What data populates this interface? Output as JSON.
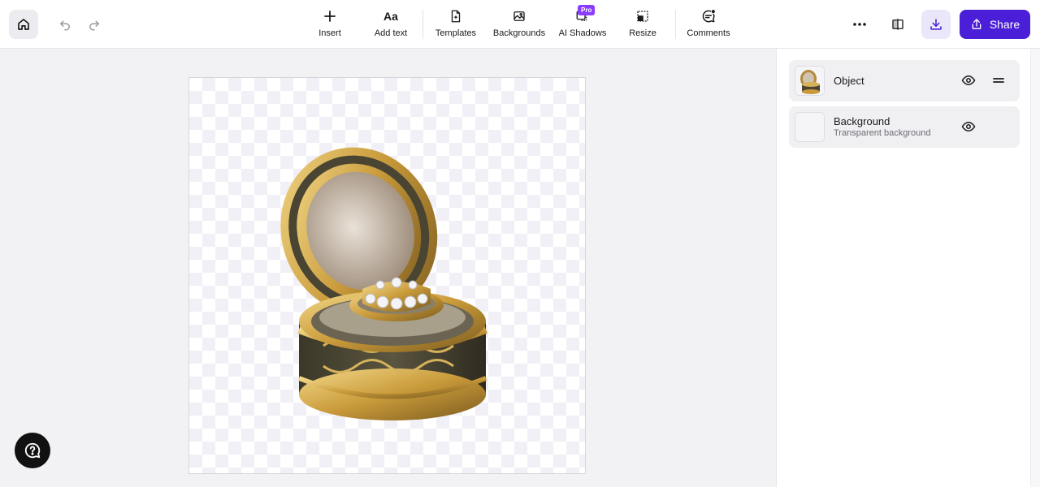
{
  "toolbar": {
    "tools": [
      {
        "label": "Insert",
        "icon": "plus-icon"
      },
      {
        "label": "Add text",
        "icon": "text-icon"
      },
      {
        "label": "Templates",
        "icon": "templates-icon"
      },
      {
        "label": "Backgrounds",
        "icon": "backgrounds-icon"
      },
      {
        "label": "AI Shadows",
        "icon": "ai-shadows-icon",
        "badge": "Pro"
      },
      {
        "label": "Resize",
        "icon": "resize-icon"
      },
      {
        "label": "Comments",
        "icon": "comments-icon"
      }
    ],
    "share_label": "Share"
  },
  "layers": [
    {
      "name": "Object",
      "subtitle": ""
    },
    {
      "name": "Background",
      "subtitle": "Transparent background"
    }
  ],
  "colors": {
    "accent": "#4b1fd8",
    "accent_light": "#ebe7fb",
    "pro_badge": "#8b3dff"
  }
}
